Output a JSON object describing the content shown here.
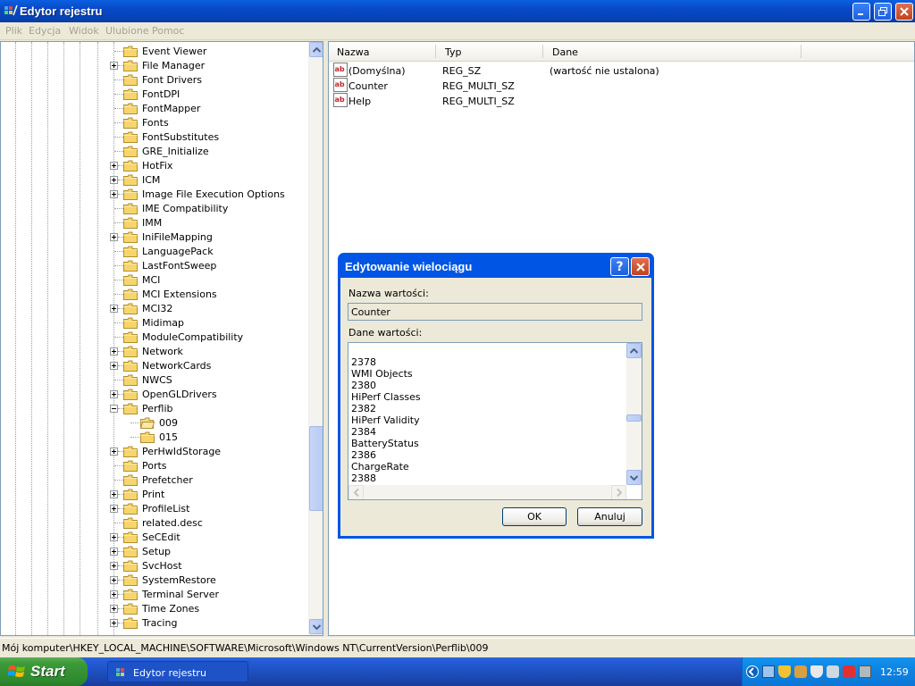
{
  "window": {
    "title": "Edytor rejestru"
  },
  "menu": [
    "Plik",
    "Edycja",
    "Widok",
    "Ulubione",
    "Pomoc"
  ],
  "tree": {
    "items": [
      {
        "label": "Event Viewer",
        "expander": "none"
      },
      {
        "label": "File Manager",
        "expander": "plus"
      },
      {
        "label": "Font Drivers",
        "expander": "none"
      },
      {
        "label": "FontDPI",
        "expander": "none"
      },
      {
        "label": "FontMapper",
        "expander": "none"
      },
      {
        "label": "Fonts",
        "expander": "none"
      },
      {
        "label": "FontSubstitutes",
        "expander": "none"
      },
      {
        "label": "GRE_Initialize",
        "expander": "none"
      },
      {
        "label": "HotFix",
        "expander": "plus"
      },
      {
        "label": "ICM",
        "expander": "plus"
      },
      {
        "label": "Image File Execution Options",
        "expander": "plus"
      },
      {
        "label": "IME Compatibility",
        "expander": "none"
      },
      {
        "label": "IMM",
        "expander": "none"
      },
      {
        "label": "IniFileMapping",
        "expander": "plus"
      },
      {
        "label": "LanguagePack",
        "expander": "none"
      },
      {
        "label": "LastFontSweep",
        "expander": "none"
      },
      {
        "label": "MCI",
        "expander": "none"
      },
      {
        "label": "MCI Extensions",
        "expander": "none"
      },
      {
        "label": "MCI32",
        "expander": "plus"
      },
      {
        "label": "Midimap",
        "expander": "none"
      },
      {
        "label": "ModuleCompatibility",
        "expander": "none"
      },
      {
        "label": "Network",
        "expander": "plus"
      },
      {
        "label": "NetworkCards",
        "expander": "plus"
      },
      {
        "label": "NWCS",
        "expander": "none"
      },
      {
        "label": "OpenGLDrivers",
        "expander": "plus"
      },
      {
        "label": "Perflib",
        "expander": "minus"
      },
      {
        "label": "009",
        "expander": "child",
        "open": true
      },
      {
        "label": "015",
        "expander": "child"
      },
      {
        "label": "PerHwIdStorage",
        "expander": "plus"
      },
      {
        "label": "Ports",
        "expander": "none"
      },
      {
        "label": "Prefetcher",
        "expander": "none"
      },
      {
        "label": "Print",
        "expander": "plus"
      },
      {
        "label": "ProfileList",
        "expander": "plus"
      },
      {
        "label": "related.desc",
        "expander": "none"
      },
      {
        "label": "SeCEdit",
        "expander": "plus"
      },
      {
        "label": "Setup",
        "expander": "plus"
      },
      {
        "label": "SvcHost",
        "expander": "plus"
      },
      {
        "label": "SystemRestore",
        "expander": "plus"
      },
      {
        "label": "Terminal Server",
        "expander": "plus"
      },
      {
        "label": "Time Zones",
        "expander": "plus"
      },
      {
        "label": "Tracing",
        "expander": "plus"
      }
    ]
  },
  "list": {
    "columns": [
      "Nazwa",
      "Typ",
      "Dane"
    ],
    "rows": [
      {
        "name": "(Domyślna)",
        "type": "REG_SZ",
        "data": "(wartość nie ustalona)"
      },
      {
        "name": "Counter",
        "type": "REG_MULTI_SZ",
        "data": ""
      },
      {
        "name": "Help",
        "type": "REG_MULTI_SZ",
        "data": ""
      }
    ]
  },
  "dialog": {
    "title": "Edytowanie wielociągu",
    "name_label": "Nazwa wartości:",
    "name_value": "Counter",
    "data_label": "Dane wartości:",
    "data_lines": [
      "2378",
      "WMI Objects",
      "2380",
      "HiPerf Classes",
      "2382",
      "HiPerf Validity",
      "2384",
      "BatteryStatus",
      "2386",
      "ChargeRate",
      "2388"
    ],
    "ok": "OK",
    "cancel": "Anuluj"
  },
  "status": "Mój komputer\\HKEY_LOCAL_MACHINE\\SOFTWARE\\Microsoft\\Windows NT\\CurrentVersion\\Perflib\\009",
  "taskbar": {
    "start": "Start",
    "task": "Edytor rejestru",
    "clock": "12:59"
  }
}
